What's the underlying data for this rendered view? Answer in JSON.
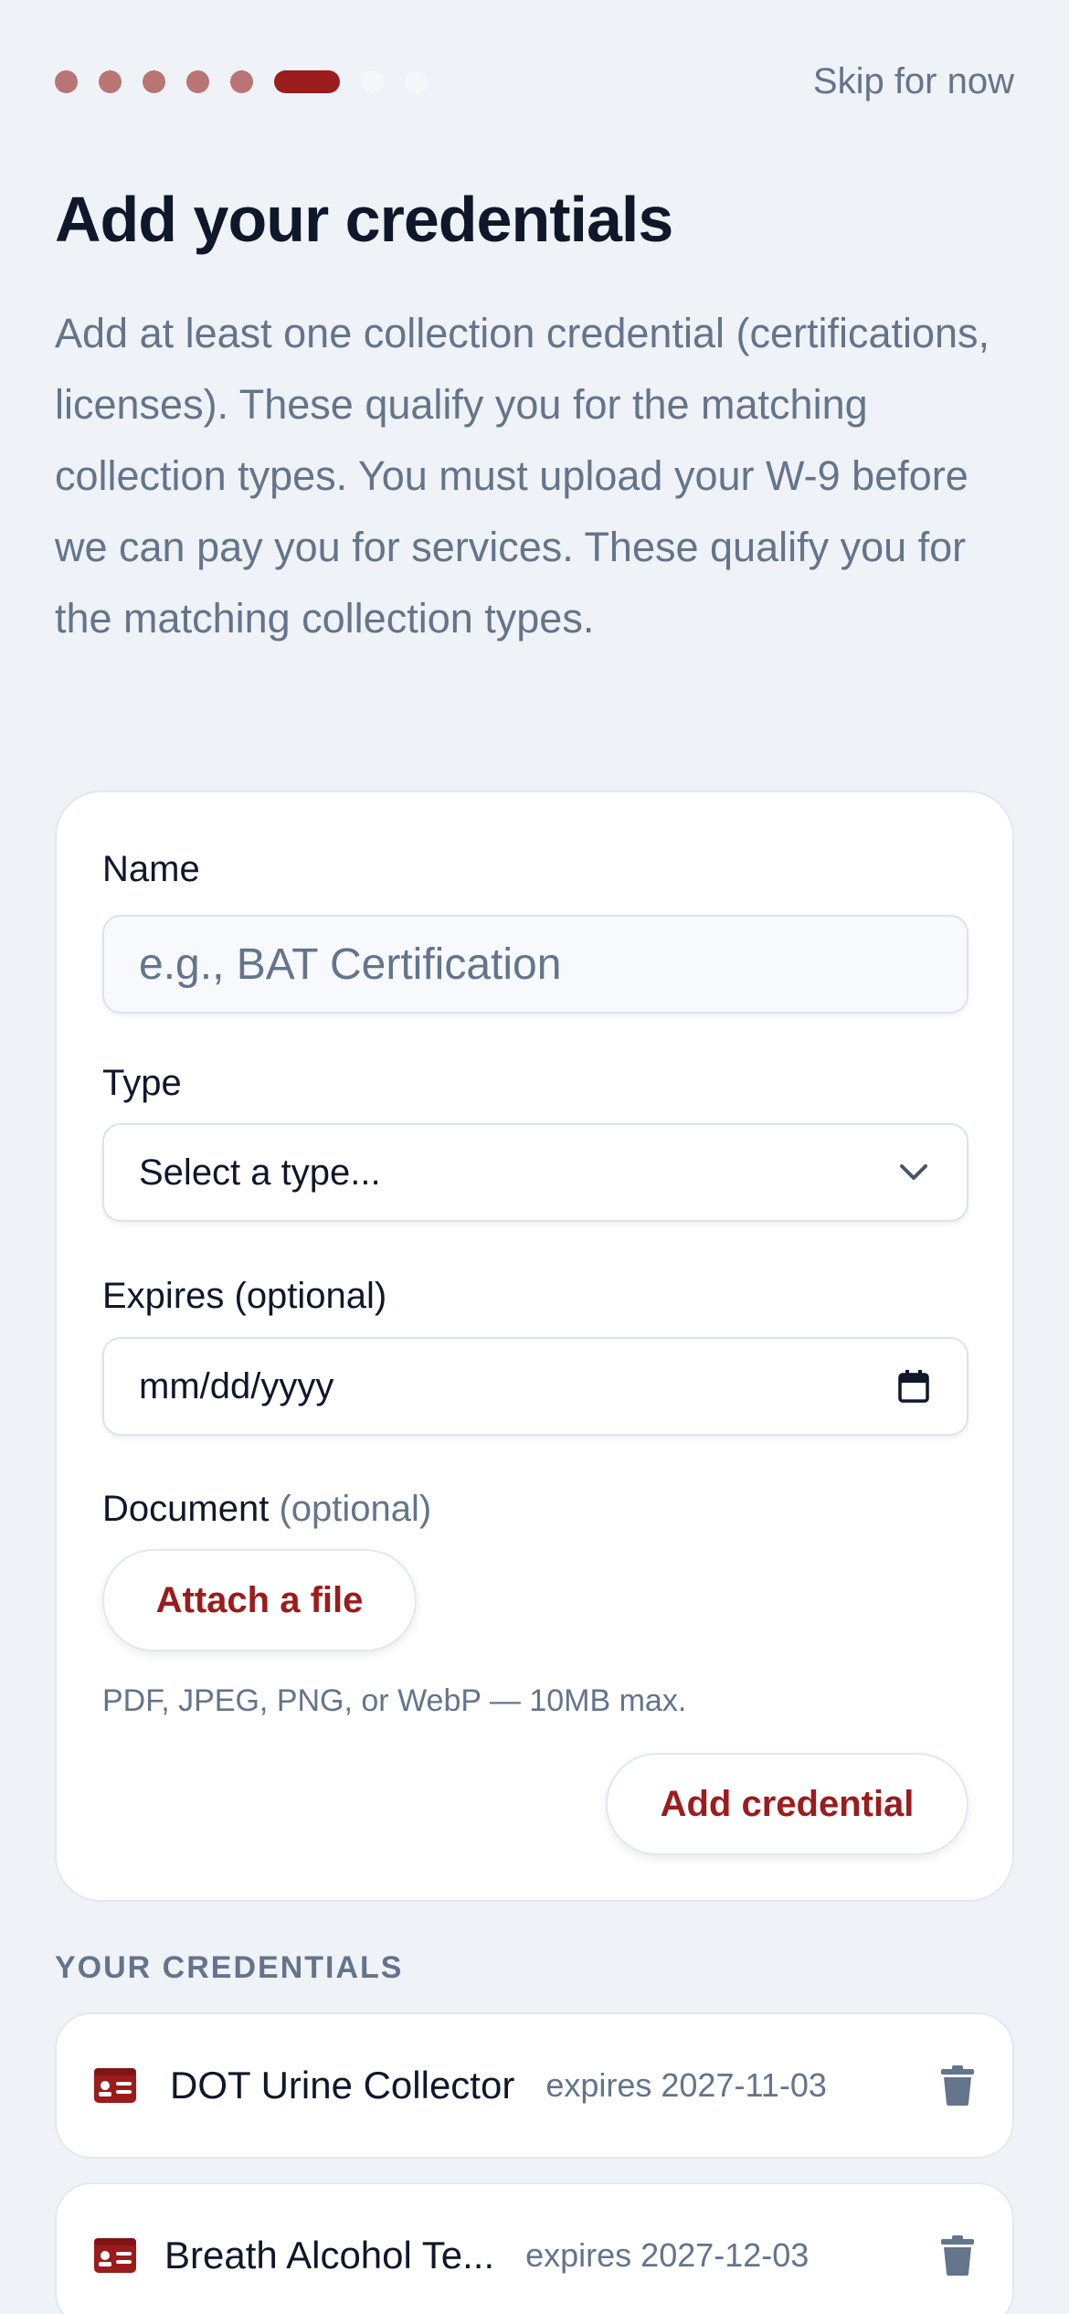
{
  "progress": {
    "total": 8,
    "current": 6
  },
  "header": {
    "skip_label": "Skip for now"
  },
  "title": "Add your credentials",
  "description": "Add at least one collection credential (certifications, licenses). These qualify you for the matching collection types. You must upload your W-9 before we can pay you for services. These qualify you for the matching collection types.",
  "form": {
    "name_label": "Name",
    "name_placeholder": "e.g., BAT Certification",
    "type_label": "Type",
    "type_value": "Select a type...",
    "expires_label": "Expires (optional)",
    "expires_value": "mm/dd/yyyy",
    "document_label": "Document",
    "document_optional": "(optional)",
    "attach_label": "Attach a file",
    "file_hint": "PDF, JPEG, PNG, or WebP — 10MB max.",
    "submit_label": "Add credential"
  },
  "credentials_section": {
    "title": "YOUR CREDENTIALS",
    "items": [
      {
        "name": "DOT Urine Collector",
        "expires": "expires 2027-11-03"
      },
      {
        "name": "Breath Alcohol Te...",
        "expires": "expires 2027-12-03"
      }
    ]
  },
  "colors": {
    "accent": "#9b1c1c",
    "muted": "#64748b",
    "background": "#eff3f8"
  },
  "icons": [
    "id-card-icon",
    "trash-icon",
    "chevron-down-icon",
    "calendar-icon"
  ]
}
